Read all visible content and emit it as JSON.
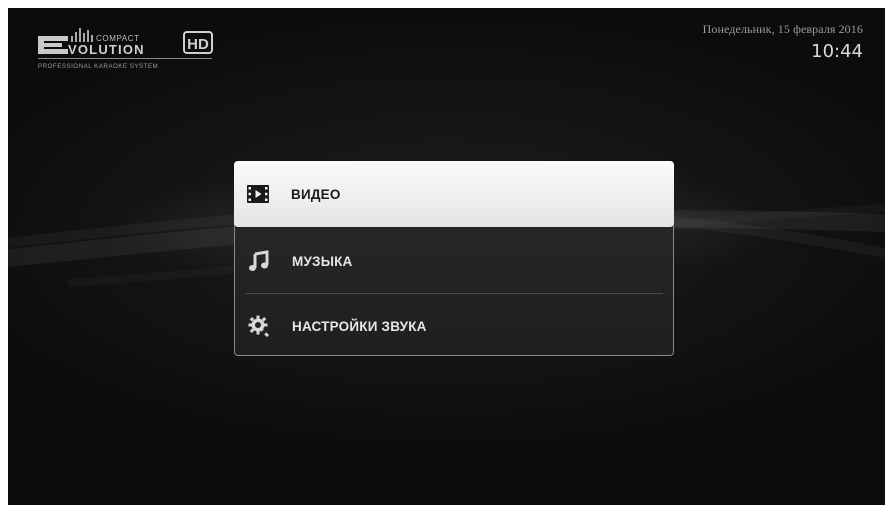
{
  "header": {
    "logo": {
      "line1": "COMPACT",
      "line2": "VOLUTION",
      "badge": "HD",
      "tagline": "PROFESSIONAL KARAOKE SYSTEM"
    },
    "date": "Понедельник, 15 февраля 2016",
    "time": "10:44"
  },
  "menu": {
    "items": [
      {
        "label": "ВИДЕО",
        "icon": "video-icon",
        "selected": true
      },
      {
        "label": "МУЗЫКА",
        "icon": "music-icon",
        "selected": false
      },
      {
        "label": "НАСТРОЙКИ ЗВУКА",
        "icon": "sound-settings-icon",
        "selected": false
      }
    ]
  },
  "colors": {
    "background": "#111111",
    "menu_background": "#252525",
    "selected_background": "#f2f2f2",
    "menu_text": "#e6e6e6",
    "selected_text": "#1a1a1a"
  }
}
